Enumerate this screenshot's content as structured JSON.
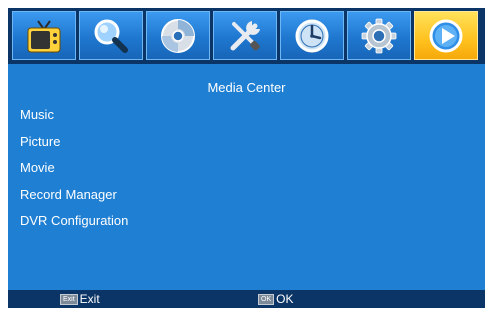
{
  "icon_bar": {
    "items": [
      {
        "icon": "tv-icon",
        "active": false
      },
      {
        "icon": "search-icon",
        "active": false
      },
      {
        "icon": "disc-icon",
        "active": false
      },
      {
        "icon": "tools-icon",
        "active": false
      },
      {
        "icon": "clock-icon",
        "active": false
      },
      {
        "icon": "gear-icon",
        "active": false
      },
      {
        "icon": "play-icon",
        "active": true
      }
    ]
  },
  "title": "Media Center",
  "menu": {
    "items": [
      {
        "label": "Music"
      },
      {
        "label": "Picture"
      },
      {
        "label": "Movie"
      },
      {
        "label": "Record Manager"
      },
      {
        "label": "DVR Configuration"
      }
    ]
  },
  "bottom_bar": {
    "exit_key": "Exit",
    "exit_label": "Exit",
    "ok_key": "OK",
    "ok_label": "OK"
  },
  "colors": {
    "background": "#1f7fd3",
    "bar": "#0b3566",
    "active_tile": "#ffc11e",
    "text": "#ffffff"
  }
}
